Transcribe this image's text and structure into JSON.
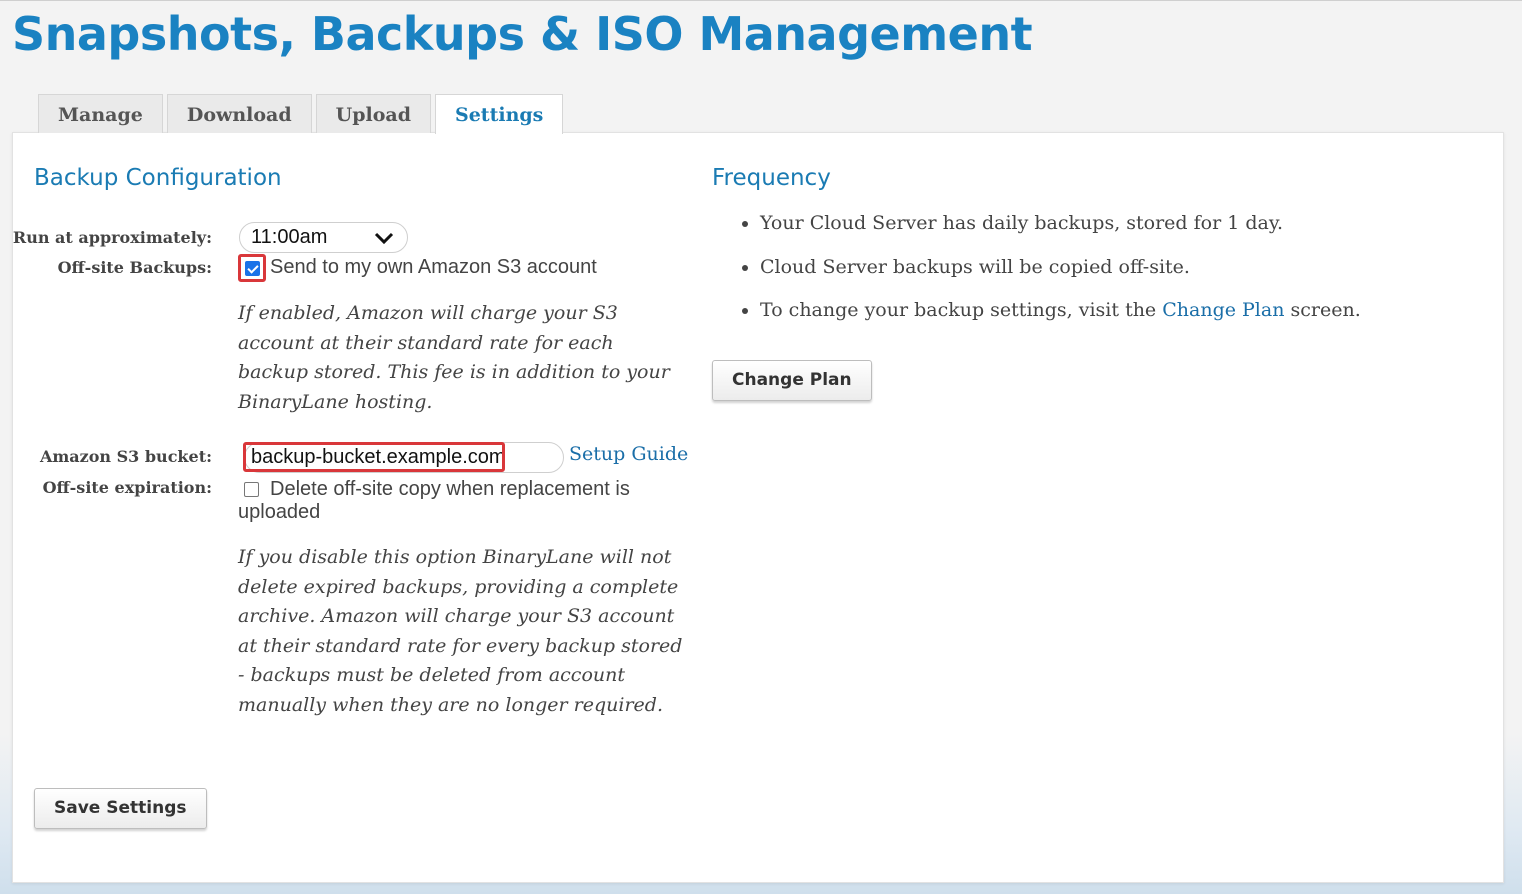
{
  "page": {
    "title": "Snapshots, Backups & ISO Management"
  },
  "tabs": [
    {
      "label": "Manage",
      "active": false
    },
    {
      "label": "Download",
      "active": false
    },
    {
      "label": "Upload",
      "active": false
    },
    {
      "label": "Settings",
      "active": true
    }
  ],
  "backup_config": {
    "heading": "Backup Configuration",
    "run_at_label": "Run at approximately:",
    "run_at_value": "11:00am",
    "offsite_label": "Off-site Backups:",
    "offsite_checked": true,
    "offsite_option": "Send to my own Amazon S3 account",
    "offsite_note": "If enabled, Amazon will charge your S3 account at their standard rate for each backup stored. This fee is in addition to your BinaryLane hosting.",
    "bucket_label": "Amazon S3 bucket:",
    "bucket_value": "backup-bucket.example.com",
    "setup_guide_link": "Setup Guide",
    "expiration_label": "Off-site expiration:",
    "expiration_checked": false,
    "expiration_option": "Delete off-site copy when replacement is uploaded",
    "expiration_note": "If you disable this option BinaryLane will not delete expired backups, providing a complete archive. Amazon will charge your S3 account at their standard rate for every backup stored - backups must be deleted from account manually when they are no longer required.",
    "save_button": "Save Settings"
  },
  "frequency": {
    "heading": "Frequency",
    "items": [
      {
        "text": "Your Cloud Server has daily backups, stored for 1 day."
      },
      {
        "text": "Cloud Server backups will be copied off-site."
      },
      {
        "text_before": "To change your backup settings, visit the ",
        "link": "Change Plan",
        "text_after": " screen."
      }
    ],
    "change_plan_button": "Change Plan"
  },
  "colors": {
    "accent": "#1a82c2",
    "highlight": "#d9373a",
    "link": "#1a6ea8"
  },
  "icons": {
    "dropdown": "chevron-down-icon",
    "checkbox_checked": "checkmark-icon"
  }
}
